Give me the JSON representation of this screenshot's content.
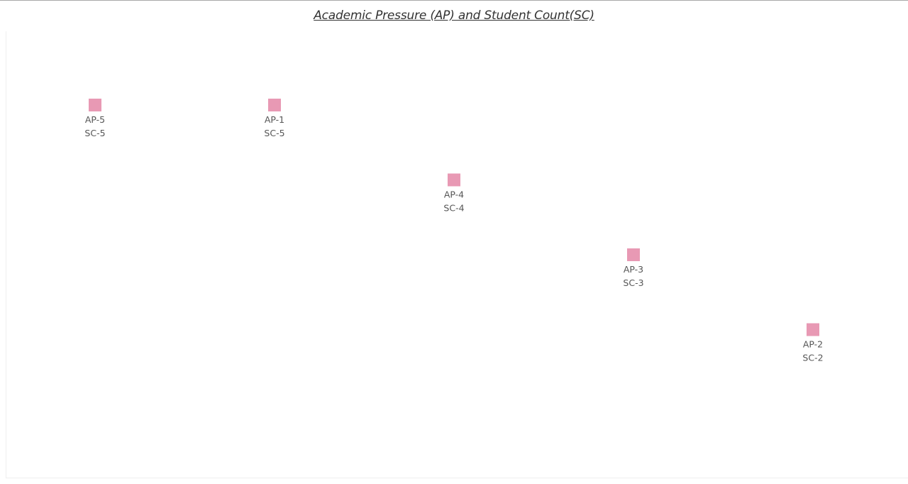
{
  "chart_data": {
    "type": "scatter",
    "title": "Academic Pressure (AP) and Student Count(SC)",
    "marker_color": "#e899b4",
    "marker_shape": "square",
    "grid": false,
    "legend": "none",
    "points": [
      {
        "label_line1": "AP-5",
        "label_line2": "SC-5",
        "column": 1,
        "y": 5
      },
      {
        "label_line1": "AP-1",
        "label_line2": "SC-5",
        "column": 2,
        "y": 5
      },
      {
        "label_line1": "AP-4",
        "label_line2": "SC-4",
        "column": 3,
        "y": 4
      },
      {
        "label_line1": "AP-3",
        "label_line2": "SC-3",
        "column": 4,
        "y": 3
      },
      {
        "label_line1": "AP-2",
        "label_line2": "SC-2",
        "column": 5,
        "y": 2
      }
    ]
  }
}
